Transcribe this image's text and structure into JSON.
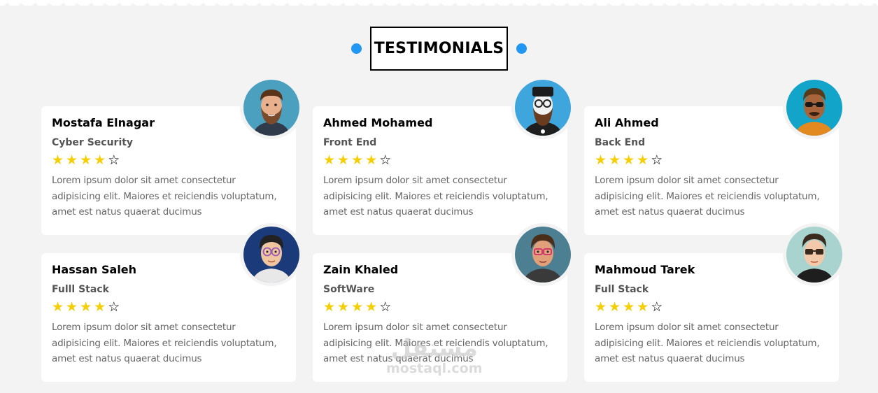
{
  "section": {
    "title": "TESTIMONIALS",
    "accent_color": "#2196f3",
    "star_color": "#f4cf06"
  },
  "testimonials": [
    {
      "name": "Mostafa Elnagar",
      "role": "Cyber Security",
      "rating": 4,
      "max_rating": 5,
      "text": "Lorem ipsum dolor sit amet consectetur adipisicing elit. Maiores et reiciendis voluptatum, amet est natus quaerat ducimus",
      "avatar": "bearded-man-avatar-icon"
    },
    {
      "name": "Ahmed Mohamed",
      "role": "Front End",
      "rating": 4,
      "max_rating": 5,
      "text": "Lorem ipsum dolor sit amet consectetur adipisicing elit. Maiores et reiciendis voluptatum, amet est natus quaerat ducimus",
      "avatar": "hipster-avatar-icon"
    },
    {
      "name": "Ali Ahmed",
      "role": "Back End",
      "rating": 4,
      "max_rating": 5,
      "text": "Lorem ipsum dolor sit amet consectetur adipisicing elit. Maiores et reiciendis voluptatum, amet est natus quaerat ducimus",
      "avatar": "sunglasses-man-avatar-icon"
    },
    {
      "name": "Hassan Saleh",
      "role": "Fulll Stack",
      "rating": 4,
      "max_rating": 5,
      "text": "Lorem ipsum dolor sit amet consectetur adipisicing elit. Maiores et reiciendis voluptatum, amet est natus quaerat ducimus",
      "avatar": "glasses-boy-avatar-icon"
    },
    {
      "name": "Zain Khaled",
      "role": "SoftWare",
      "rating": 4,
      "max_rating": 5,
      "text": "Lorem ipsum dolor sit amet consectetur adipisicing elit. Maiores et reiciendis voluptatum, amet est natus quaerat ducimus",
      "avatar": "glasses-man-avatar-icon"
    },
    {
      "name": "Mahmoud Tarek",
      "role": "Full Stack",
      "rating": 4,
      "max_rating": 5,
      "text": "Lorem ipsum dolor sit amet consectetur adipisicing elit. Maiores et reiciendis voluptatum, amet est natus quaerat ducimus",
      "avatar": "dark-glasses-man-avatar-icon"
    }
  ],
  "watermark": {
    "arabic": "مستقل",
    "latin": "mostaql.com"
  }
}
